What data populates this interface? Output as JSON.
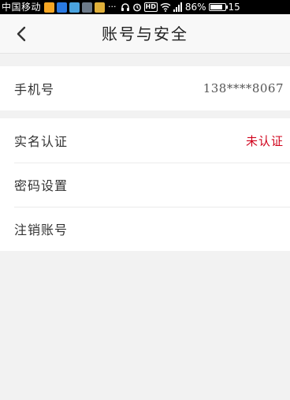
{
  "status_bar": {
    "carrier": "中国移动",
    "more": "···",
    "hd": "HD",
    "battery_text": "86%",
    "battery_level": 0.86,
    "time_partial": "15",
    "badge_colors": [
      "#f5a623",
      "#2a7ae2",
      "#4aa3df",
      "#6c7a89",
      "#e0b03a"
    ]
  },
  "header": {
    "title": "账号与安全",
    "back_icon": "chevron-left-icon"
  },
  "phone": {
    "label": "手机号",
    "value": "138****8067"
  },
  "security": {
    "rows": [
      {
        "label": "实名认证",
        "value": "未认证"
      },
      {
        "label": "密码设置"
      },
      {
        "label": "注销账号"
      }
    ]
  },
  "colors": {
    "background": "#f2f2f2",
    "accent_red": "#d0021b",
    "card": "#ffffff"
  }
}
